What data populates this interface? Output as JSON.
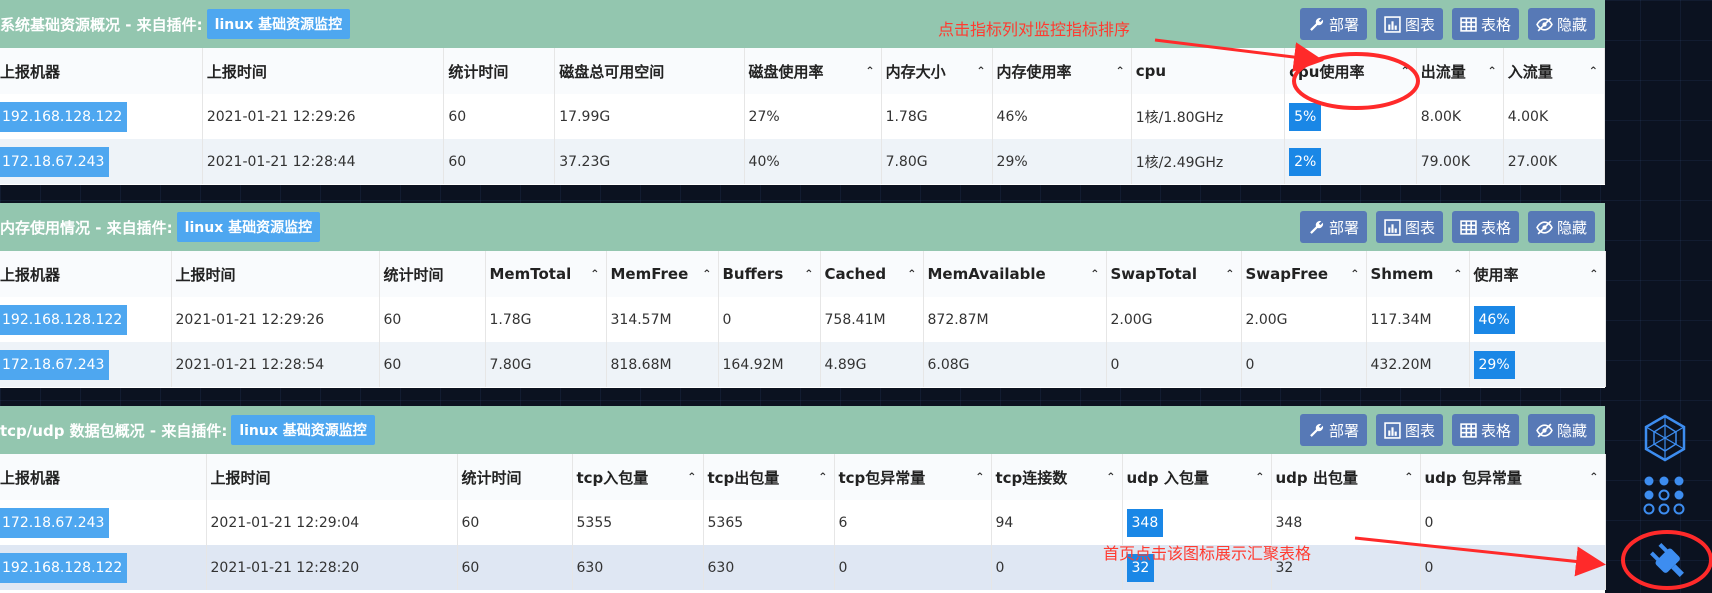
{
  "panels": [
    {
      "title": "系统基础资源概况 - 来自插件:",
      "plugin": "linux 基础资源监控",
      "toolbar": [
        "部署",
        "图表",
        "表格",
        "隐藏"
      ],
      "columns": [
        "上报机器",
        "上报时间",
        "统计时间",
        "磁盘总可用空间",
        "磁盘使用率",
        "内存大小",
        "内存使用率",
        "cpu",
        "cpu使用率",
        "出流量",
        "入流量"
      ],
      "rows": [
        [
          "192.168.128.122",
          "2021-01-21 12:29:26",
          "60",
          "17.99G",
          "27%",
          "1.78G",
          "46%",
          "1核/1.80GHz",
          "5%",
          "8.00K",
          "4.00K"
        ],
        [
          "172.18.67.243",
          "2021-01-21 12:28:44",
          "60",
          "37.23G",
          "40%",
          "7.80G",
          "29%",
          "1核/2.49GHz",
          "2%",
          "79.00K",
          "27.00K"
        ]
      ]
    },
    {
      "title": "内存使用情况 - 来自插件:",
      "plugin": "linux 基础资源监控",
      "toolbar": [
        "部署",
        "图表",
        "表格",
        "隐藏"
      ],
      "columns": [
        "上报机器",
        "上报时间",
        "统计时间",
        "MemTotal",
        "MemFree",
        "Buffers",
        "Cached",
        "MemAvailable",
        "SwapTotal",
        "SwapFree",
        "Shmem",
        "使用率"
      ],
      "rows": [
        [
          "192.168.128.122",
          "2021-01-21 12:29:26",
          "60",
          "1.78G",
          "314.57M",
          "0",
          "758.41M",
          "872.87M",
          "2.00G",
          "2.00G",
          "117.34M",
          "46%"
        ],
        [
          "172.18.67.243",
          "2021-01-21 12:28:54",
          "60",
          "7.80G",
          "818.68M",
          "164.92M",
          "4.89G",
          "6.08G",
          "0",
          "0",
          "432.20M",
          "29%"
        ]
      ]
    },
    {
      "title": "tcp/udp 数据包概况 - 来自插件:",
      "plugin": "linux 基础资源监控",
      "toolbar": [
        "部署",
        "图表",
        "表格",
        "隐藏"
      ],
      "columns": [
        "上报机器",
        "上报时间",
        "统计时间",
        "tcp入包量",
        "tcp出包量",
        "tcp包异常量",
        "tcp连接数",
        "udp 入包量",
        "udp 出包量",
        "udp 包异常量"
      ],
      "rows": [
        [
          "172.18.67.243",
          "2021-01-21 12:29:04",
          "60",
          "5355",
          "5365",
          "6",
          "94",
          "348",
          "348",
          "0"
        ],
        [
          "192.168.128.122",
          "2021-01-21 12:28:20",
          "60",
          "630",
          "630",
          "0",
          "0",
          "32",
          "32",
          "0"
        ]
      ]
    }
  ],
  "annotations": {
    "sort_hint": "点击指标列对监控指标排序",
    "home_hint": "首页点击该图标展示汇聚表格"
  },
  "sidebar_icons": [
    "hexagon-icon",
    "dots-grid-icon",
    "plugin-icon"
  ],
  "colors": {
    "header_green": "#93c6af",
    "chip_blue": "#4ea7f0",
    "tool_btn": "#5779b6",
    "annot_red": "#ff3b30"
  }
}
